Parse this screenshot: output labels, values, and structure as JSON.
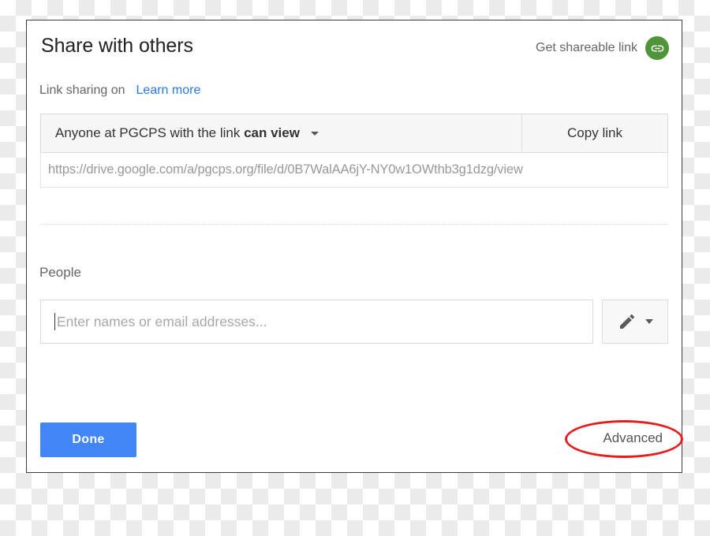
{
  "dialog": {
    "title": "Share with others",
    "shareable_link": {
      "label": "Get shareable link",
      "icon": "link-chain-icon",
      "icon_color": "#4f9439"
    },
    "link_sharing": {
      "status_text": "Link sharing on",
      "learn_more_label": "Learn more",
      "learn_more_color": "#2878ea",
      "scope_prefix": "Anyone at PGCPS with the link",
      "scope_permission": "can view",
      "dropdown_icon": "chevron-down-icon",
      "copy_link_label": "Copy link",
      "url": "https://drive.google.com/a/pgcps.org/file/d/0B7WalAA6jY-NY0w1OWthb3g1dzg/view"
    },
    "people": {
      "section_label": "People",
      "input_placeholder": "Enter names or email addresses...",
      "input_value": "",
      "role_icon": "pencil-icon",
      "role_dropdown_icon": "chevron-down-icon"
    },
    "footer": {
      "done_label": "Done",
      "done_color": "#4285f4",
      "advanced_label": "Advanced"
    }
  },
  "annotation": {
    "shape": "ellipse",
    "color": "#e81c1c",
    "target": "Advanced"
  }
}
